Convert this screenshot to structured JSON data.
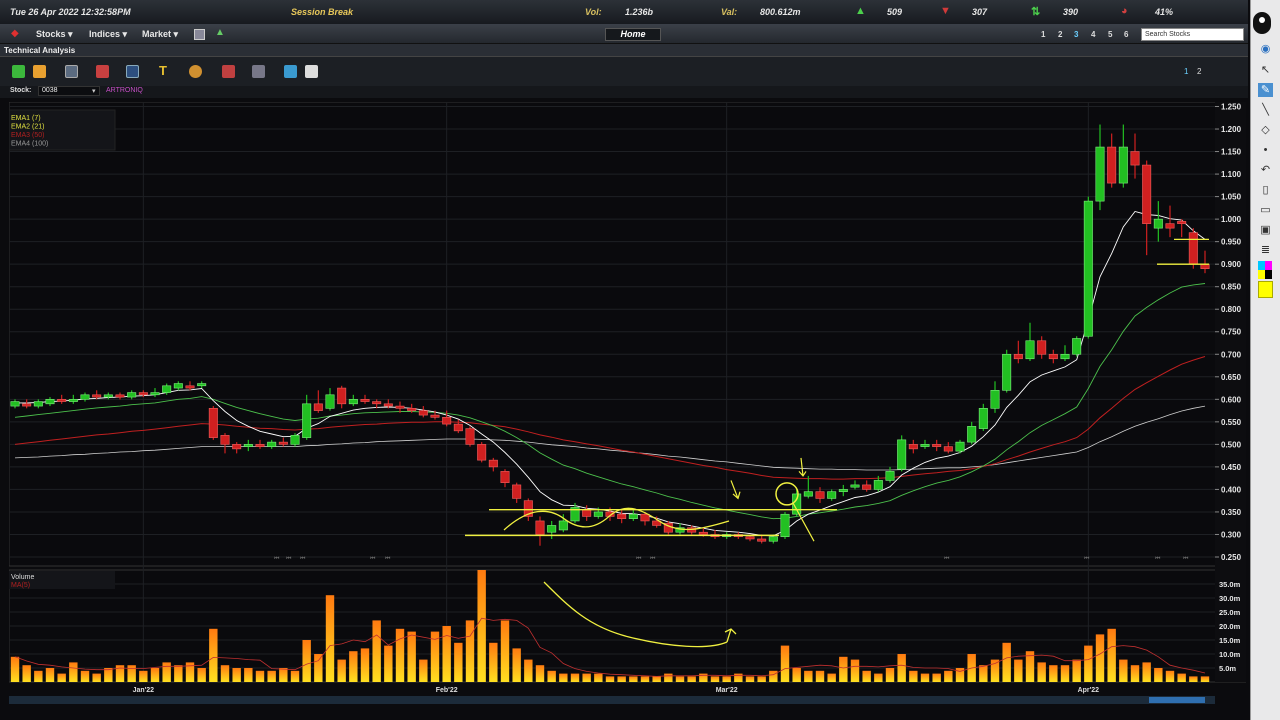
{
  "status": {
    "datetime": "Tue 26 Apr 2022   12:32:58PM",
    "session": "Session Break",
    "vol_label": "Vol:",
    "vol_value": "1.236b",
    "val_label": "Val:",
    "val_value": "800.612m",
    "gainers": "509",
    "losers": "307",
    "unchanged": "390",
    "pct": "41%"
  },
  "menu": {
    "stocks": "Stocks",
    "indices": "Indices",
    "market": "Market",
    "home": "Home",
    "pages": [
      "1",
      "2",
      "3",
      "4",
      "5",
      "6"
    ],
    "active_page": "3",
    "search_placeholder": "Search Stocks"
  },
  "window_title": "Technical Analysis",
  "toolbar_pages": [
    "1",
    "2"
  ],
  "stock": {
    "label": "Stock:",
    "code": "0038",
    "name": "ARTRONIQ"
  },
  "colors": {
    "up": "#22c022",
    "down": "#d02020",
    "ema1": "#ffffff",
    "ema2": "#4cc04c",
    "ema3": "#c02020",
    "ema4": "#d0d0d0",
    "annotation": "#f0f040",
    "volume": "#f0a020"
  },
  "chart_data": {
    "type": "candlestick",
    "legend": [
      "EMA1 (7)",
      "EMA2 (21)",
      "EMA3 (50)",
      "EMA4 (100)"
    ],
    "yticks": [
      "1.250",
      "1.200",
      "1.150",
      "1.100",
      "1.050",
      "1.000",
      "0.950",
      "0.900",
      "0.850",
      "0.800",
      "0.750",
      "0.700",
      "0.650",
      "0.600",
      "0.550",
      "0.500",
      "0.450",
      "0.400",
      "0.350",
      "0.300",
      "0.250"
    ],
    "ylim": [
      0.23,
      1.26
    ],
    "xlabels": [
      "Jan'22",
      "Feb'22",
      "Mar'22",
      "Apr'22"
    ],
    "candles": [
      [
        0.585,
        0.595,
        0.6,
        0.58
      ],
      [
        0.59,
        0.585,
        0.6,
        0.58
      ],
      [
        0.585,
        0.595,
        0.6,
        0.58
      ],
      [
        0.59,
        0.6,
        0.605,
        0.585
      ],
      [
        0.6,
        0.595,
        0.61,
        0.59
      ],
      [
        0.595,
        0.6,
        0.61,
        0.59
      ],
      [
        0.6,
        0.61,
        0.615,
        0.595
      ],
      [
        0.61,
        0.605,
        0.62,
        0.6
      ],
      [
        0.605,
        0.61,
        0.615,
        0.6
      ],
      [
        0.61,
        0.605,
        0.615,
        0.6
      ],
      [
        0.605,
        0.615,
        0.62,
        0.6
      ],
      [
        0.615,
        0.61,
        0.62,
        0.605
      ],
      [
        0.61,
        0.615,
        0.625,
        0.605
      ],
      [
        0.615,
        0.63,
        0.635,
        0.61
      ],
      [
        0.625,
        0.635,
        0.64,
        0.62
      ],
      [
        0.63,
        0.625,
        0.64,
        0.62
      ],
      [
        0.63,
        0.635,
        0.64,
        0.625
      ],
      [
        0.58,
        0.515,
        0.585,
        0.51
      ],
      [
        0.52,
        0.5,
        0.525,
        0.48
      ],
      [
        0.5,
        0.49,
        0.505,
        0.48
      ],
      [
        0.495,
        0.5,
        0.51,
        0.485
      ],
      [
        0.5,
        0.495,
        0.51,
        0.49
      ],
      [
        0.495,
        0.505,
        0.51,
        0.49
      ],
      [
        0.505,
        0.5,
        0.515,
        0.495
      ],
      [
        0.5,
        0.52,
        0.525,
        0.495
      ],
      [
        0.515,
        0.59,
        0.61,
        0.51
      ],
      [
        0.59,
        0.575,
        0.62,
        0.57
      ],
      [
        0.58,
        0.61,
        0.625,
        0.575
      ],
      [
        0.625,
        0.59,
        0.63,
        0.58
      ],
      [
        0.59,
        0.6,
        0.61,
        0.585
      ],
      [
        0.6,
        0.595,
        0.61,
        0.59
      ],
      [
        0.595,
        0.59,
        0.6,
        0.58
      ],
      [
        0.59,
        0.585,
        0.6,
        0.58
      ],
      [
        0.585,
        0.58,
        0.595,
        0.57
      ],
      [
        0.58,
        0.575,
        0.59,
        0.57
      ],
      [
        0.575,
        0.565,
        0.585,
        0.56
      ],
      [
        0.565,
        0.56,
        0.575,
        0.555
      ],
      [
        0.56,
        0.545,
        0.575,
        0.54
      ],
      [
        0.545,
        0.53,
        0.555,
        0.525
      ],
      [
        0.535,
        0.5,
        0.54,
        0.495
      ],
      [
        0.5,
        0.465,
        0.505,
        0.46
      ],
      [
        0.465,
        0.45,
        0.47,
        0.44
      ],
      [
        0.44,
        0.415,
        0.445,
        0.405
      ],
      [
        0.41,
        0.38,
        0.415,
        0.37
      ],
      [
        0.375,
        0.34,
        0.38,
        0.33
      ],
      [
        0.33,
        0.3,
        0.34,
        0.275
      ],
      [
        0.305,
        0.32,
        0.33,
        0.29
      ],
      [
        0.31,
        0.33,
        0.345,
        0.305
      ],
      [
        0.33,
        0.36,
        0.37,
        0.325
      ],
      [
        0.355,
        0.34,
        0.365,
        0.33
      ],
      [
        0.34,
        0.35,
        0.36,
        0.335
      ],
      [
        0.35,
        0.34,
        0.36,
        0.33
      ],
      [
        0.345,
        0.335,
        0.355,
        0.325
      ],
      [
        0.335,
        0.345,
        0.355,
        0.33
      ],
      [
        0.345,
        0.33,
        0.35,
        0.32
      ],
      [
        0.33,
        0.32,
        0.34,
        0.315
      ],
      [
        0.325,
        0.305,
        0.33,
        0.3
      ],
      [
        0.305,
        0.315,
        0.325,
        0.3
      ],
      [
        0.315,
        0.305,
        0.32,
        0.3
      ],
      [
        0.305,
        0.3,
        0.315,
        0.295
      ],
      [
        0.3,
        0.295,
        0.31,
        0.29
      ],
      [
        0.295,
        0.3,
        0.305,
        0.29
      ],
      [
        0.3,
        0.295,
        0.305,
        0.29
      ],
      [
        0.295,
        0.29,
        0.3,
        0.285
      ],
      [
        0.29,
        0.285,
        0.3,
        0.28
      ],
      [
        0.285,
        0.295,
        0.3,
        0.28
      ],
      [
        0.295,
        0.345,
        0.35,
        0.29
      ],
      [
        0.345,
        0.39,
        0.4,
        0.34
      ],
      [
        0.385,
        0.395,
        0.43,
        0.38
      ],
      [
        0.395,
        0.38,
        0.405,
        0.37
      ],
      [
        0.38,
        0.395,
        0.4,
        0.375
      ],
      [
        0.395,
        0.4,
        0.41,
        0.385
      ],
      [
        0.405,
        0.41,
        0.42,
        0.4
      ],
      [
        0.41,
        0.4,
        0.42,
        0.395
      ],
      [
        0.4,
        0.42,
        0.43,
        0.395
      ],
      [
        0.42,
        0.44,
        0.45,
        0.415
      ],
      [
        0.445,
        0.51,
        0.52,
        0.44
      ],
      [
        0.5,
        0.49,
        0.51,
        0.48
      ],
      [
        0.495,
        0.5,
        0.51,
        0.49
      ],
      [
        0.5,
        0.495,
        0.51,
        0.485
      ],
      [
        0.495,
        0.485,
        0.505,
        0.48
      ],
      [
        0.485,
        0.505,
        0.51,
        0.48
      ],
      [
        0.505,
        0.54,
        0.55,
        0.5
      ],
      [
        0.535,
        0.58,
        0.59,
        0.53
      ],
      [
        0.58,
        0.62,
        0.64,
        0.57
      ],
      [
        0.62,
        0.7,
        0.71,
        0.615
      ],
      [
        0.7,
        0.69,
        0.73,
        0.68
      ],
      [
        0.69,
        0.73,
        0.77,
        0.685
      ],
      [
        0.73,
        0.7,
        0.74,
        0.69
      ],
      [
        0.7,
        0.69,
        0.71,
        0.68
      ],
      [
        0.69,
        0.7,
        0.72,
        0.685
      ],
      [
        0.7,
        0.735,
        0.74,
        0.695
      ],
      [
        0.74,
        1.04,
        1.05,
        0.735
      ],
      [
        1.04,
        1.16,
        1.21,
        1.02
      ],
      [
        1.16,
        1.08,
        1.19,
        1.07
      ],
      [
        1.08,
        1.16,
        1.21,
        1.07
      ],
      [
        1.15,
        1.12,
        1.19,
        1.09
      ],
      [
        1.12,
        0.99,
        1.13,
        0.92
      ],
      [
        0.98,
        1.0,
        1.04,
        0.95
      ],
      [
        0.99,
        0.98,
        1.03,
        0.96
      ],
      [
        0.995,
        0.99,
        1.0,
        0.96
      ],
      [
        0.97,
        0.9,
        0.98,
        0.89
      ],
      [
        0.9,
        0.89,
        0.93,
        0.88
      ]
    ],
    "ema1": [
      0.592,
      0.592,
      0.593,
      0.595,
      0.596,
      0.598,
      0.601,
      0.602,
      0.604,
      0.605,
      0.607,
      0.608,
      0.61,
      0.615,
      0.62,
      0.621,
      0.624,
      0.597,
      0.573,
      0.553,
      0.54,
      0.529,
      0.523,
      0.517,
      0.518,
      0.536,
      0.546,
      0.562,
      0.569,
      0.576,
      0.58,
      0.582,
      0.583,
      0.582,
      0.58,
      0.576,
      0.572,
      0.565,
      0.556,
      0.542,
      0.523,
      0.505,
      0.482,
      0.456,
      0.427,
      0.395,
      0.377,
      0.365,
      0.364,
      0.358,
      0.356,
      0.352,
      0.347,
      0.346,
      0.342,
      0.336,
      0.328,
      0.324,
      0.319,
      0.314,
      0.309,
      0.307,
      0.305,
      0.302,
      0.298,
      0.297,
      0.309,
      0.33,
      0.345,
      0.354,
      0.364,
      0.373,
      0.382,
      0.386,
      0.394,
      0.406,
      0.432,
      0.447,
      0.46,
      0.469,
      0.474,
      0.482,
      0.496,
      0.517,
      0.543,
      0.582,
      0.609,
      0.639,
      0.654,
      0.663,
      0.672,
      0.688,
      0.776,
      0.872,
      0.924,
      0.983,
      1.017,
      1.01,
      1.008,
      1.001,
      0.998,
      0.974,
      0.955
    ],
    "ema2": [
      0.56,
      0.563,
      0.566,
      0.569,
      0.572,
      0.575,
      0.578,
      0.581,
      0.583,
      0.585,
      0.588,
      0.59,
      0.592,
      0.596,
      0.6,
      0.602,
      0.606,
      0.6,
      0.591,
      0.582,
      0.575,
      0.568,
      0.562,
      0.556,
      0.553,
      0.556,
      0.558,
      0.563,
      0.565,
      0.568,
      0.57,
      0.571,
      0.572,
      0.573,
      0.573,
      0.572,
      0.571,
      0.569,
      0.565,
      0.559,
      0.55,
      0.541,
      0.529,
      0.515,
      0.499,
      0.481,
      0.467,
      0.454,
      0.446,
      0.436,
      0.428,
      0.42,
      0.412,
      0.406,
      0.399,
      0.392,
      0.384,
      0.378,
      0.371,
      0.365,
      0.359,
      0.354,
      0.349,
      0.344,
      0.339,
      0.335,
      0.336,
      0.34,
      0.345,
      0.348,
      0.352,
      0.356,
      0.361,
      0.364,
      0.369,
      0.375,
      0.387,
      0.397,
      0.406,
      0.414,
      0.42,
      0.428,
      0.439,
      0.452,
      0.467,
      0.488,
      0.506,
      0.526,
      0.542,
      0.555,
      0.568,
      0.583,
      0.624,
      0.673,
      0.71,
      0.751,
      0.785,
      0.804,
      0.821,
      0.836,
      0.849,
      0.854,
      0.857
    ],
    "ema3": [
      0.5,
      0.503,
      0.506,
      0.509,
      0.512,
      0.515,
      0.518,
      0.521,
      0.523,
      0.526,
      0.529,
      0.531,
      0.534,
      0.537,
      0.54,
      0.543,
      0.546,
      0.545,
      0.543,
      0.54,
      0.538,
      0.536,
      0.535,
      0.533,
      0.532,
      0.534,
      0.535,
      0.538,
      0.54,
      0.542,
      0.544,
      0.545,
      0.547,
      0.548,
      0.549,
      0.549,
      0.55,
      0.55,
      0.549,
      0.548,
      0.545,
      0.542,
      0.539,
      0.534,
      0.528,
      0.521,
      0.516,
      0.51,
      0.506,
      0.501,
      0.497,
      0.492,
      0.487,
      0.483,
      0.478,
      0.473,
      0.468,
      0.463,
      0.458,
      0.453,
      0.449,
      0.444,
      0.44,
      0.436,
      0.431,
      0.427,
      0.426,
      0.425,
      0.424,
      0.424,
      0.423,
      0.423,
      0.424,
      0.424,
      0.425,
      0.426,
      0.429,
      0.432,
      0.435,
      0.437,
      0.44,
      0.442,
      0.446,
      0.451,
      0.457,
      0.466,
      0.474,
      0.483,
      0.491,
      0.499,
      0.506,
      0.515,
      0.534,
      0.559,
      0.58,
      0.602,
      0.622,
      0.637,
      0.651,
      0.665,
      0.678,
      0.687,
      0.695
    ],
    "ema4": [
      0.47,
      0.471,
      0.472,
      0.474,
      0.475,
      0.477,
      0.478,
      0.48,
      0.481,
      0.483,
      0.484,
      0.486,
      0.487,
      0.489,
      0.491,
      0.493,
      0.495,
      0.495,
      0.495,
      0.495,
      0.495,
      0.495,
      0.495,
      0.495,
      0.495,
      0.497,
      0.498,
      0.5,
      0.501,
      0.503,
      0.504,
      0.506,
      0.507,
      0.508,
      0.509,
      0.51,
      0.511,
      0.512,
      0.512,
      0.512,
      0.511,
      0.51,
      0.509,
      0.507,
      0.505,
      0.502,
      0.499,
      0.497,
      0.495,
      0.492,
      0.49,
      0.487,
      0.485,
      0.482,
      0.48,
      0.477,
      0.474,
      0.472,
      0.469,
      0.466,
      0.463,
      0.461,
      0.458,
      0.455,
      0.452,
      0.449,
      0.448,
      0.447,
      0.446,
      0.445,
      0.445,
      0.444,
      0.444,
      0.443,
      0.443,
      0.443,
      0.444,
      0.445,
      0.446,
      0.447,
      0.448,
      0.448,
      0.45,
      0.452,
      0.455,
      0.459,
      0.463,
      0.467,
      0.471,
      0.475,
      0.479,
      0.483,
      0.493,
      0.506,
      0.517,
      0.529,
      0.54,
      0.549,
      0.557,
      0.566,
      0.574,
      0.58,
      0.585
    ],
    "volume_label": "Volume",
    "volume_ma_label": "MA(5)",
    "volume_ticks": [
      "35.0m",
      "30.0m",
      "25.0m",
      "20.0m",
      "15.0m",
      "10.0m",
      "5.0m"
    ],
    "volume_ylim": [
      0,
      40
    ],
    "volumes": [
      9,
      6,
      4,
      5,
      3,
      7,
      4,
      3,
      5,
      6,
      6,
      4,
      5,
      7,
      6,
      7,
      5,
      19,
      6,
      5,
      5,
      4,
      4,
      5,
      4,
      15,
      10,
      31,
      8,
      11,
      12,
      22,
      13,
      19,
      18,
      8,
      18,
      20,
      14,
      22,
      40,
      14,
      22,
      12,
      8,
      6,
      4,
      3,
      3,
      3,
      3,
      2,
      2,
      2,
      2,
      2,
      3,
      2,
      2,
      3,
      2,
      2,
      3,
      2,
      2,
      4,
      13,
      5,
      4,
      4,
      3,
      9,
      8,
      4,
      3,
      5,
      10,
      4,
      3,
      3,
      4,
      5,
      10,
      6,
      8,
      14,
      8,
      11,
      7,
      6,
      6,
      8,
      13,
      17,
      19,
      8,
      6,
      7,
      5,
      4,
      3,
      2,
      2
    ]
  }
}
